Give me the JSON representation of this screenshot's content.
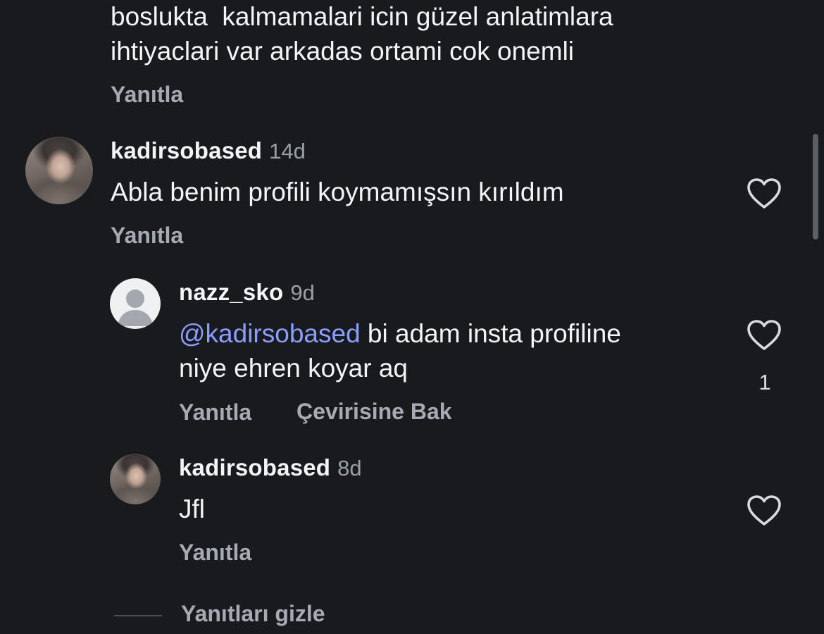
{
  "top_comment": {
    "text_line1": "boslukta  kalmamalari icin güzel anlatimlara",
    "text_line2": "ihtiyaclari var arkadas ortami cok onemli",
    "reply_label": "Yanıtla"
  },
  "comments": [
    {
      "username": "kadirsobased",
      "time": "14d",
      "text": "Abla benim profili koymamışsın kırıldım",
      "reply_label": "Yanıtla",
      "avatar": "profile-photo"
    }
  ],
  "replies": [
    {
      "username": "nazz_sko",
      "time": "9d",
      "mention": "@kadirsobased",
      "text_after_mention": " bi adam insta profiline",
      "text_line2": "niye ehren koyar aq",
      "like_count": "1",
      "reply_label": "Yanıtla",
      "translate_label": "Çevirisine Bak",
      "avatar": "default-avatar"
    },
    {
      "username": "kadirsobased",
      "time": "8d",
      "text": "Jfl",
      "reply_label": "Yanıtla",
      "avatar": "profile-photo"
    }
  ],
  "hide_replies_label": "Yanıtları gizle",
  "colors": {
    "background": "#181a1e",
    "text": "#f3f4f6",
    "muted": "#9aa0a8",
    "mention": "#8b9dff"
  }
}
